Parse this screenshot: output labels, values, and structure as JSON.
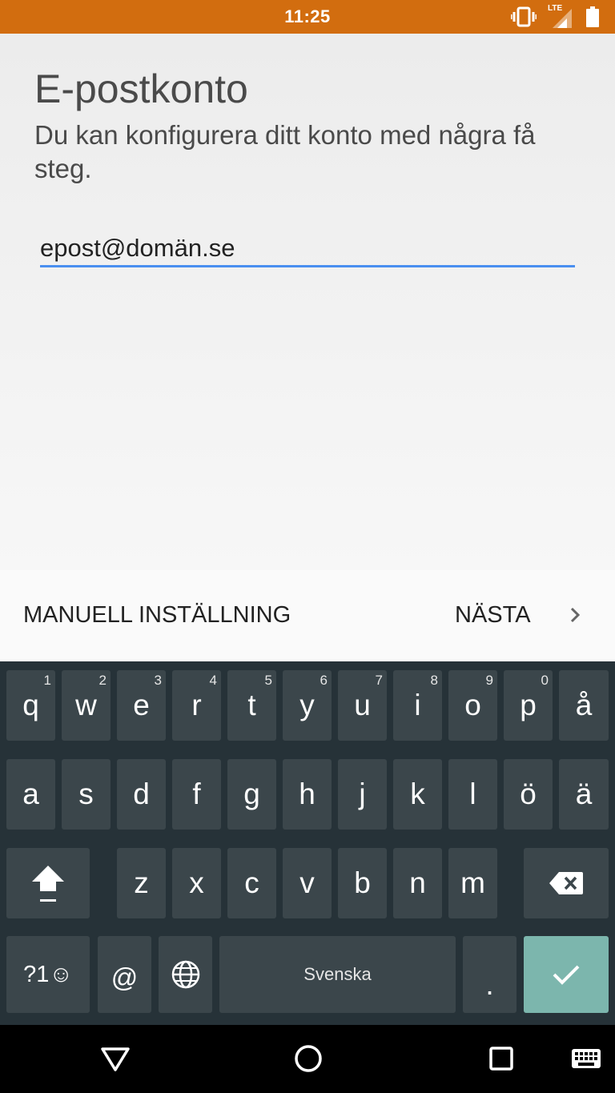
{
  "status_bar": {
    "time": "11:25",
    "network": "LTE"
  },
  "page": {
    "title": "E-postkonto",
    "subtitle": "Du kan konfigurera ditt konto med några få steg.",
    "email_value": "epost@domän.se"
  },
  "actions": {
    "manual_label": "MANUELL INSTÄLLNING",
    "next_label": "NÄSTA"
  },
  "keyboard": {
    "row1": [
      {
        "k": "q",
        "h": "1"
      },
      {
        "k": "w",
        "h": "2"
      },
      {
        "k": "e",
        "h": "3"
      },
      {
        "k": "r",
        "h": "4"
      },
      {
        "k": "t",
        "h": "5"
      },
      {
        "k": "y",
        "h": "6"
      },
      {
        "k": "u",
        "h": "7"
      },
      {
        "k": "i",
        "h": "8"
      },
      {
        "k": "o",
        "h": "9"
      },
      {
        "k": "p",
        "h": "0"
      },
      {
        "k": "å",
        "h": ""
      }
    ],
    "row2": [
      "a",
      "s",
      "d",
      "f",
      "g",
      "h",
      "j",
      "k",
      "l",
      "ö",
      "ä"
    ],
    "row3": [
      "z",
      "x",
      "c",
      "v",
      "b",
      "n",
      "m"
    ],
    "symbols_label": "?1☺",
    "at_label": "@",
    "space_label": "Svenska",
    "period_label": "."
  },
  "colors": {
    "status_bar": "#d26d0f",
    "keyboard_bg": "#263238",
    "key_bg": "#3b464b",
    "enter_key": "#7cb6ad",
    "input_underline": "#4a8ff0"
  }
}
